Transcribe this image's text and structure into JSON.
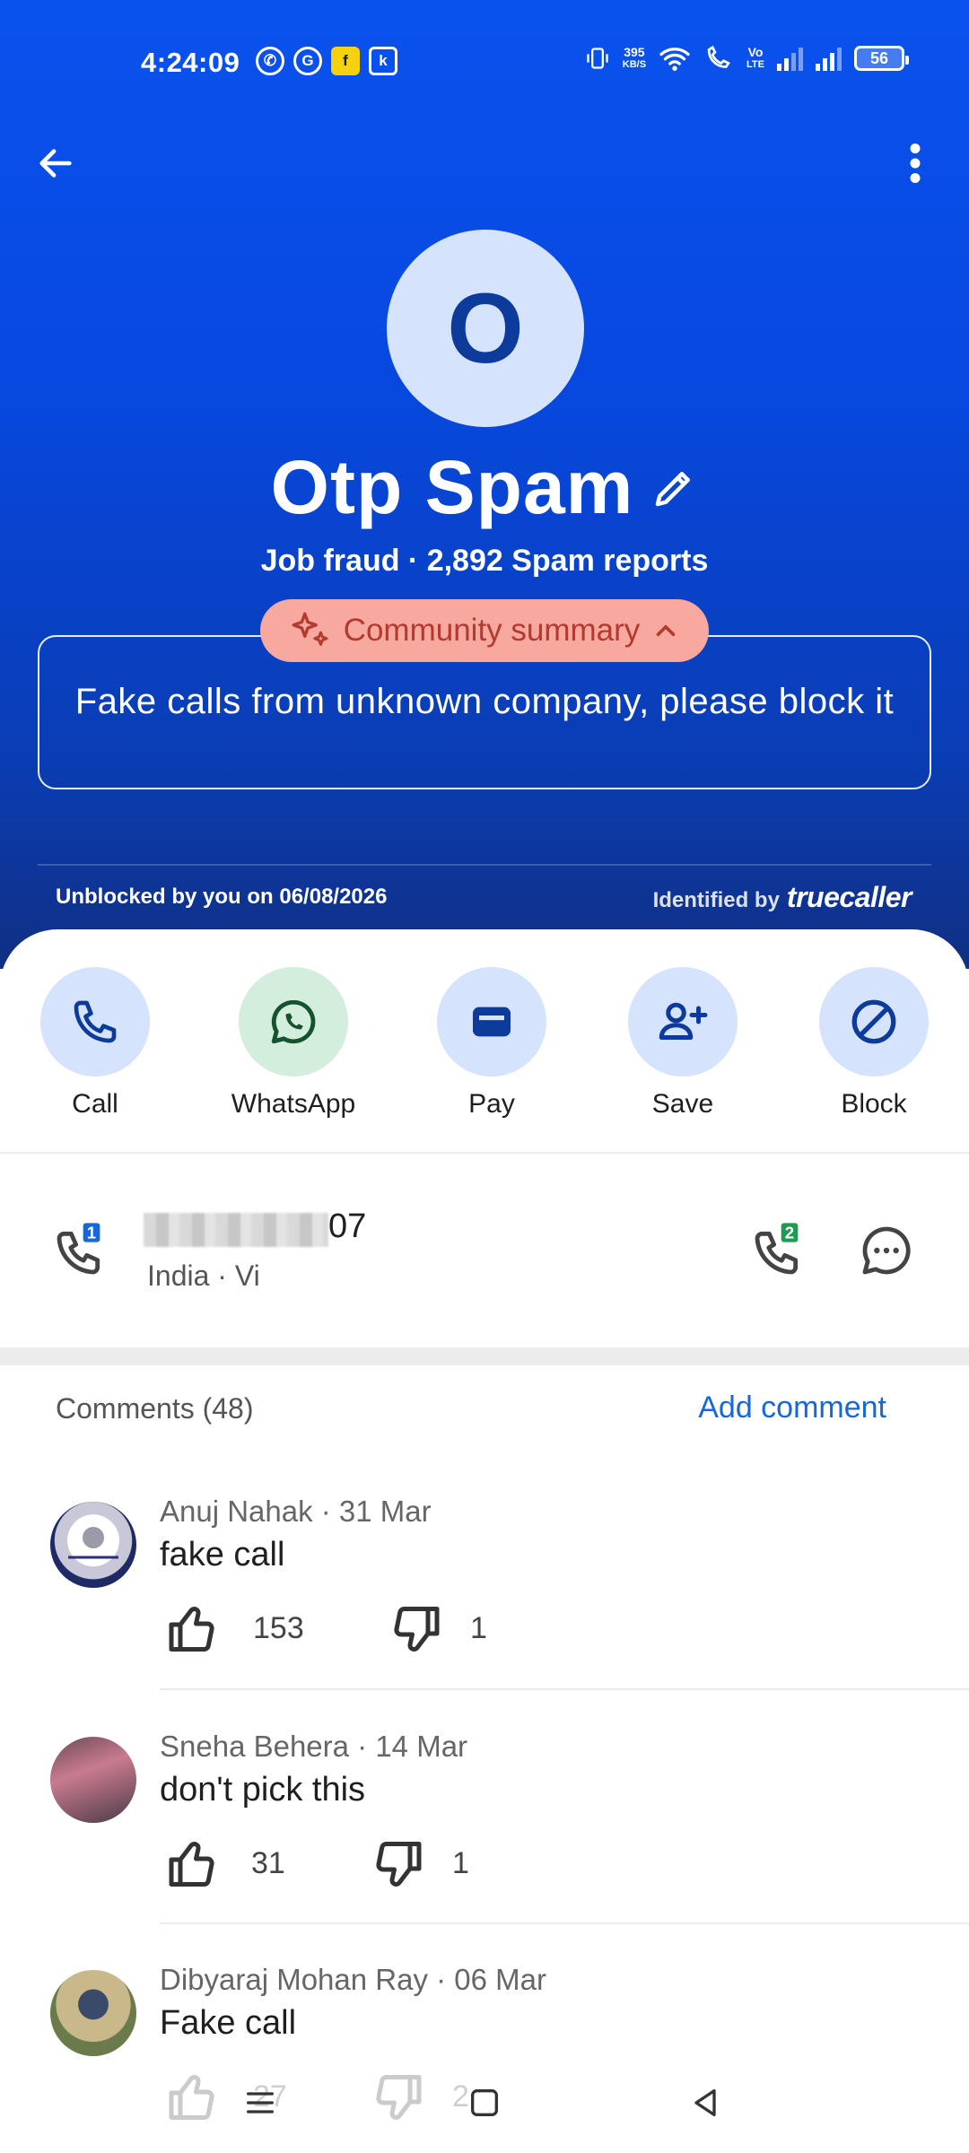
{
  "status_bar": {
    "time": "4:24:09",
    "net_speed_value": "395",
    "net_speed_unit": "KB/S",
    "volte": "Vo",
    "lte": "LTE",
    "battery": "56"
  },
  "contact": {
    "avatar_initial": "O",
    "name": "Otp Spam",
    "subline": "Job fraud · 2,892 Spam reports"
  },
  "community_summary": {
    "label": "Community summary",
    "text": "Fake calls from unknown company, please block it"
  },
  "footer": {
    "unblocked": "Unblocked by you on 06/08/2026",
    "identified_by": "Identified by",
    "brand": "truecaller"
  },
  "actions": [
    {
      "label": "Call",
      "icon": "phone-icon"
    },
    {
      "label": "WhatsApp",
      "icon": "whatsapp-icon"
    },
    {
      "label": "Pay",
      "icon": "wallet-icon"
    },
    {
      "label": "Save",
      "icon": "add-person-icon"
    },
    {
      "label": "Block",
      "icon": "block-icon"
    }
  ],
  "number": {
    "suffix": "07",
    "carrier": "India · Vi",
    "sim1_badge": "1",
    "sim2_badge": "2"
  },
  "comments": {
    "header": "Comments (48)",
    "add_label": "Add comment",
    "items": [
      {
        "author_meta": "Anuj Nahak · 31 Mar",
        "text": "fake call",
        "likes": "153",
        "dislikes": "1"
      },
      {
        "author_meta": "Sneha Behera · 14 Mar",
        "text": "don't pick this",
        "likes": "31",
        "dislikes": "1"
      },
      {
        "author_meta": "Dibyaraj Mohan Ray · 06 Mar",
        "text": "Fake call",
        "likes": "27",
        "dislikes": "2"
      }
    ]
  },
  "colors": {
    "hero_blue": "#0748df",
    "accent_blue": "#1667d9",
    "pill_bg": "#f7a9a0",
    "pill_text": "#b23a2e"
  }
}
